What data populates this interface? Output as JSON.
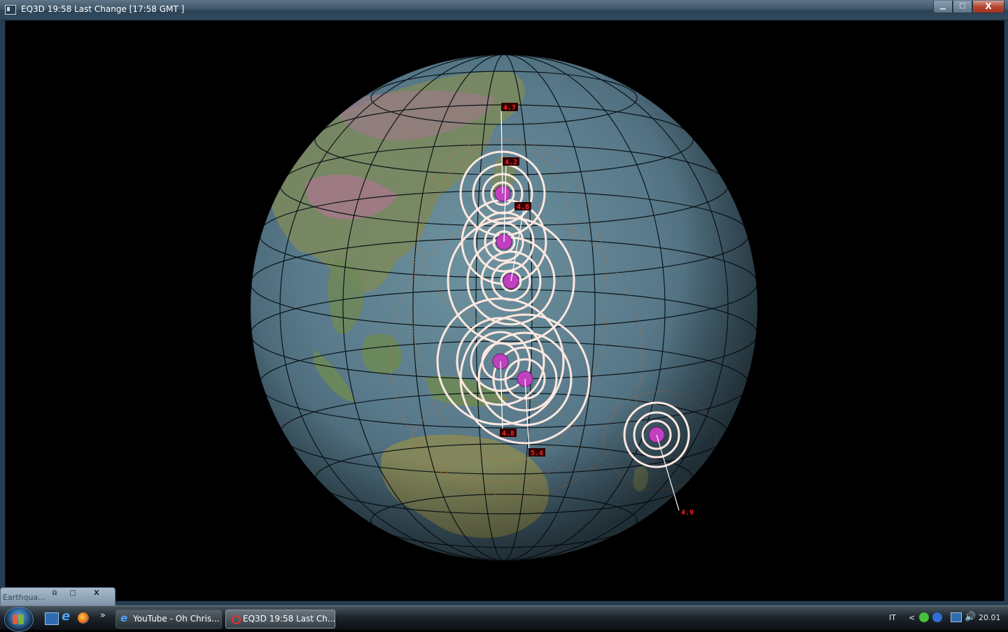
{
  "window": {
    "title": "EQ3D  19:58 Last Change  [17:58 GMT ]",
    "buttons": {
      "minimize": "▁",
      "maximize": "□",
      "close": "X"
    }
  },
  "quakes": [
    {
      "magnitude": "4.7"
    },
    {
      "magnitude": "4.2"
    },
    {
      "magnitude": "4.8"
    },
    {
      "magnitude": "4.8"
    },
    {
      "magnitude": "5.4"
    },
    {
      "magnitude": "4.9"
    }
  ],
  "minimized_window": {
    "label": "Earthqua...",
    "buttons": {
      "restore": "⧉",
      "maximize": "□",
      "close": "X"
    }
  },
  "taskbar": {
    "quicklaunch": {
      "more": "»"
    },
    "tasks": [
      {
        "label": "YouTube - Oh Chris...",
        "icon": "internet-explorer-icon"
      },
      {
        "label": "EQ3D  19:58 Last Ch...",
        "icon": "eq3d-target-icon"
      }
    ],
    "tray": {
      "language": "IT",
      "expand": "<",
      "clock": "20.01"
    }
  },
  "colors": {
    "title_bar": "#40586c",
    "globe_ocean": "#5a7c86",
    "land": "#7d8a5a",
    "rings": "#ffe8e0",
    "epicenter": "#c040c0",
    "wave_dots": "#d86a20",
    "label_bg": "#300000",
    "label_text": "#ff2020"
  }
}
